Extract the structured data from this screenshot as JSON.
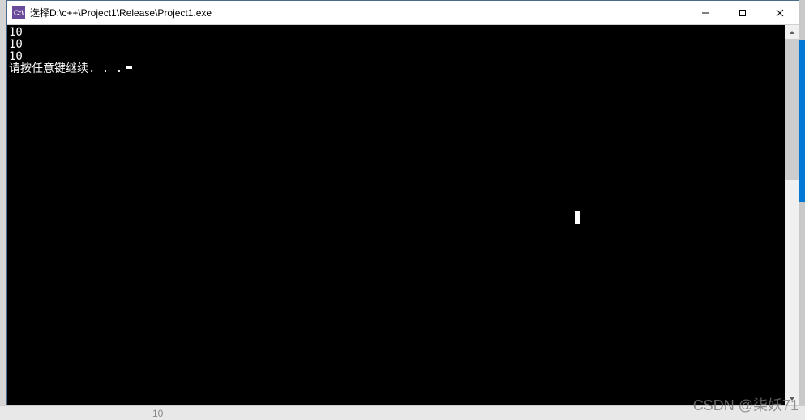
{
  "window": {
    "icon_label": "C:\\",
    "title": "选择D:\\c++\\Project1\\Release\\Project1.exe"
  },
  "controls": {
    "minimize": "—",
    "maximize": "□",
    "close": "✕"
  },
  "console": {
    "lines": [
      "10",
      "10",
      "10"
    ],
    "prompt": "请按任意键继续. . . "
  },
  "watermark": "CSDN @柒妖71",
  "bottom": {
    "text": ""
  },
  "bottom_num": "10"
}
